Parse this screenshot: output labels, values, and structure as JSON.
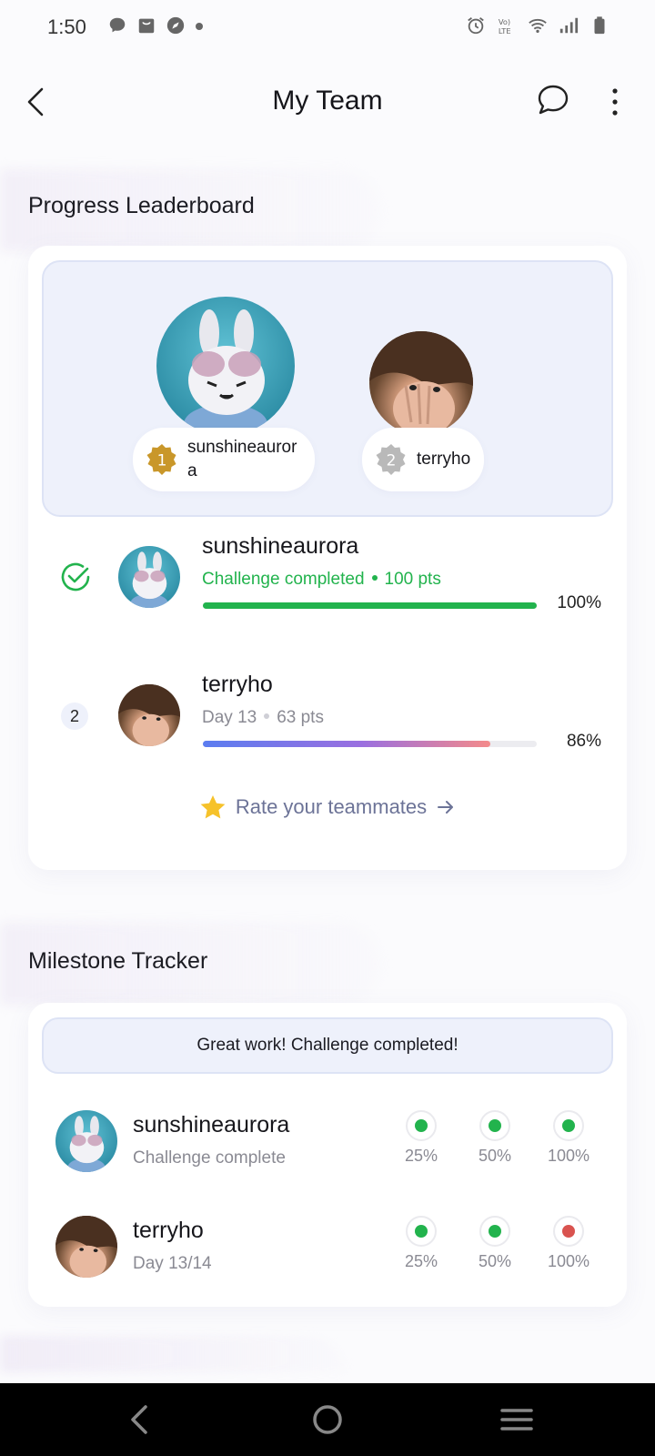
{
  "status_bar": {
    "time": "1:50",
    "icons": [
      "messenger-icon",
      "bag-icon",
      "compass-icon",
      "dot-icon",
      "alarm-icon",
      "volte-icon",
      "wifi-icon",
      "signal-icon",
      "battery-icon"
    ]
  },
  "header": {
    "title": "My Team",
    "icons": [
      "back-arrow-icon",
      "chat-bubble-icon",
      "more-vertical-icon"
    ]
  },
  "leaderboard": {
    "section_title": "Progress Leaderboard",
    "podium": [
      {
        "rank": "1",
        "name": "sunshineauror",
        "name_wrap": "a",
        "medal_color": "#c9972a"
      },
      {
        "rank": "2",
        "name": "terryho",
        "medal_color": "#b9b9b9"
      }
    ],
    "rows": [
      {
        "rank_marker": "check",
        "name": "sunshineaurora",
        "status": "Challenge completed",
        "points": "100 pts",
        "progress": 1.0,
        "percent": "100%"
      },
      {
        "rank_marker": "2",
        "name": "terryho",
        "status": "Day 13",
        "points": "63 pts",
        "progress": 0.86,
        "percent": "86%"
      }
    ],
    "rate_link": "Rate your teammates",
    "rate_icon": "star-icon"
  },
  "milestones": {
    "section_title": "Milestone Tracker",
    "banner": "Great work! Challenge completed!",
    "labels": [
      "25%",
      "50%",
      "100%"
    ],
    "rows": [
      {
        "name": "sunshineaurora",
        "sub": "Challenge complete",
        "states": [
          "complete",
          "complete",
          "complete"
        ]
      },
      {
        "name": "terryho",
        "sub": "Day 13/14",
        "states": [
          "complete",
          "complete",
          "missed"
        ]
      }
    ]
  },
  "colors": {
    "accent_green": "#22b34d",
    "missed_red": "#d9534f",
    "gradient_start": "#5b7df0",
    "gradient_mid": "#9a6fe0",
    "gradient_end": "#f48a8a"
  }
}
